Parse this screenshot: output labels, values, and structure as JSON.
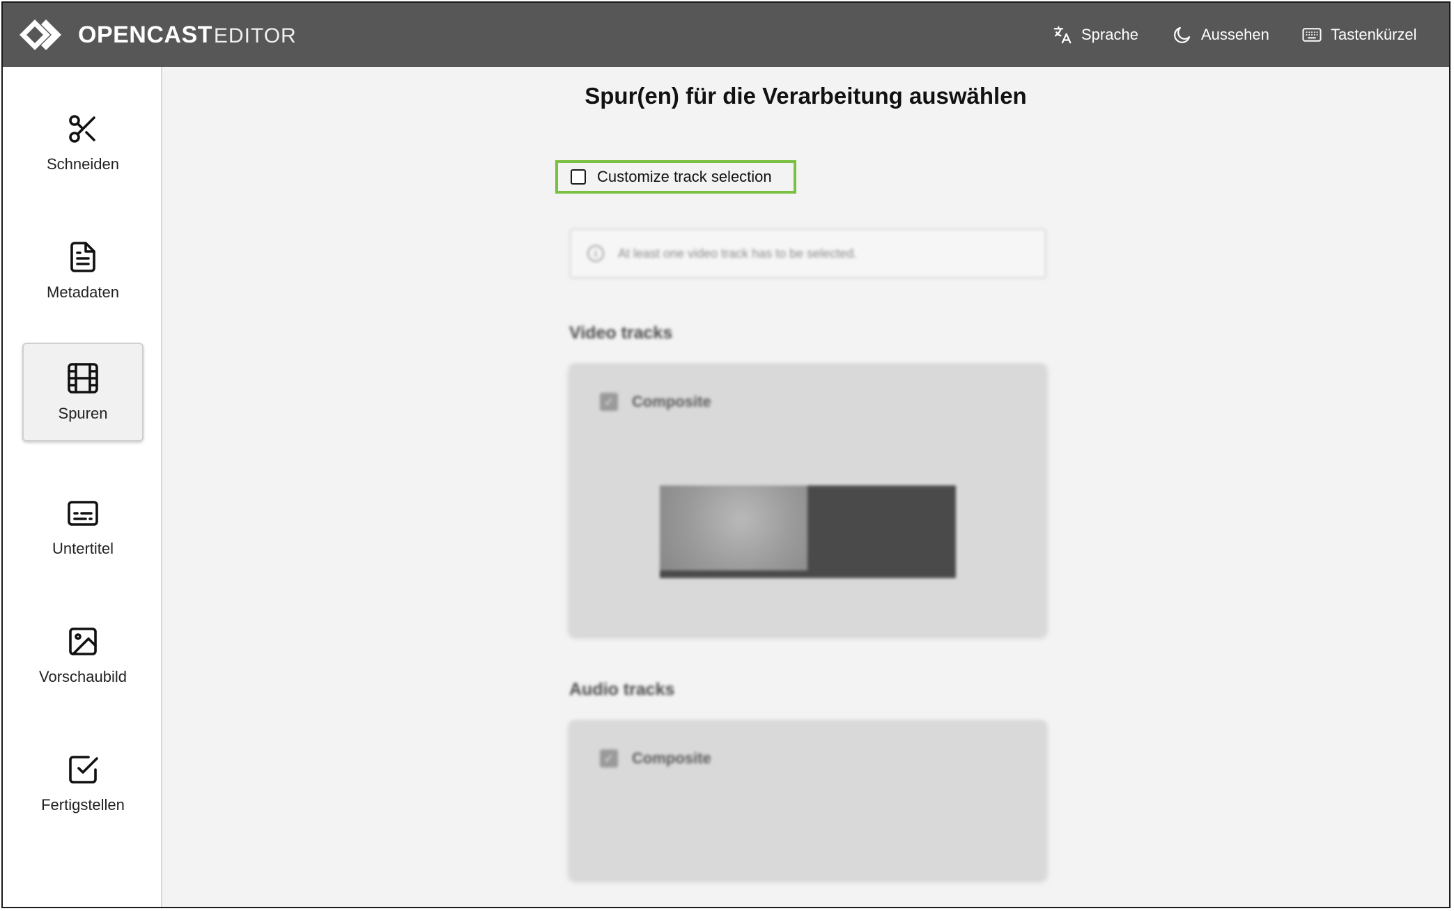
{
  "header": {
    "logo_bold": "OPENCAST",
    "logo_light": "EDITOR",
    "nav": [
      {
        "label": "Sprache",
        "icon": "translate-icon"
      },
      {
        "label": "Aussehen",
        "icon": "moon-icon"
      },
      {
        "label": "Tastenkürzel",
        "icon": "keyboard-icon"
      }
    ]
  },
  "sidebar": {
    "items": [
      {
        "label": "Schneiden",
        "icon": "scissors-icon",
        "active": false
      },
      {
        "label": "Metadaten",
        "icon": "document-icon",
        "active": false
      },
      {
        "label": "Spuren",
        "icon": "film-icon",
        "active": true
      },
      {
        "label": "Untertitel",
        "icon": "subtitles-icon",
        "active": false
      },
      {
        "label": "Vorschaubild",
        "icon": "image-icon",
        "active": false
      },
      {
        "label": "Fertigstellen",
        "icon": "checkbox-icon",
        "active": false
      }
    ]
  },
  "main": {
    "title": "Spur(en) für die Verarbeitung auswählen",
    "customize_label": "Customize track selection",
    "customize_checked": false,
    "info_text": "At least one video track has to be selected.",
    "video_section": "Video tracks",
    "audio_section": "Audio tracks",
    "video_track": {
      "label": "Composite",
      "checked": true
    },
    "audio_track": {
      "label": "Composite",
      "checked": true
    }
  },
  "colors": {
    "header_bg": "#575757",
    "highlight_border": "#7ac142",
    "page_bg": "#f3f3f3"
  }
}
